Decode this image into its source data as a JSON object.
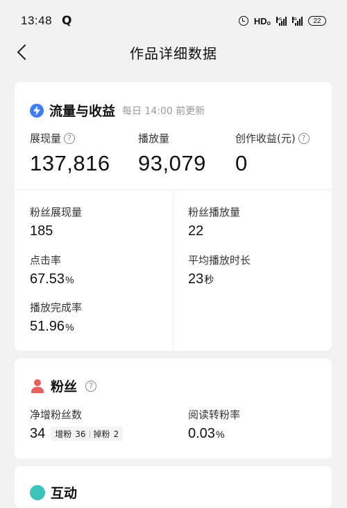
{
  "status_bar": {
    "time": "13:48",
    "app_icon": "Q",
    "network": "HDₒ",
    "signal1_label": "⁴ᴳ",
    "signal2_label": "³ᴳ",
    "battery": "22"
  },
  "nav": {
    "title": "作品详细数据"
  },
  "traffic": {
    "title": "流量与收益",
    "update_note": "每日 14:00 前更新",
    "top_metrics": [
      {
        "label": "展现量",
        "value": "137,816"
      },
      {
        "label": "播放量",
        "value": "93,079"
      },
      {
        "label": "创作收益(元)",
        "value": "0"
      }
    ],
    "details": [
      {
        "label": "粉丝展现量",
        "value": "185",
        "unit": ""
      },
      {
        "label": "粉丝播放量",
        "value": "22",
        "unit": ""
      },
      {
        "label": "点击率",
        "value": "67.53",
        "unit": "%"
      },
      {
        "label": "平均播放时长",
        "value": "23",
        "unit": "秒"
      },
      {
        "label": "播放完成率",
        "value": "51.96",
        "unit": "%"
      }
    ]
  },
  "fans": {
    "title": "粉丝",
    "net_label": "净增粉丝数",
    "net_value": "34",
    "gain_label": "增粉",
    "gain_value": "36",
    "loss_label": "掉粉",
    "loss_value": "2",
    "conv_label": "阅读转粉率",
    "conv_value": "0.03",
    "conv_unit": "%"
  },
  "interaction": {
    "title": "互动"
  },
  "colors": {
    "accent_blue": "#3f7df6",
    "fans_red": "#e8615b",
    "interact_teal": "#3cc4bb"
  }
}
